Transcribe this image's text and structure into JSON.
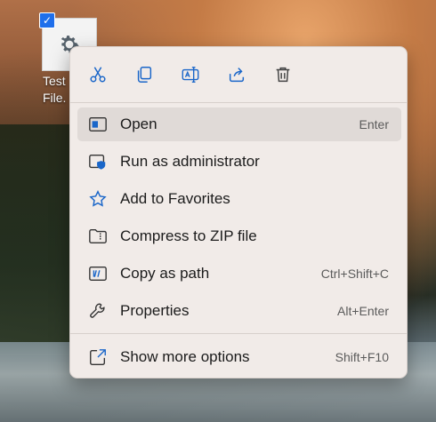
{
  "desktop": {
    "icon_label": "Test\nFile.",
    "icon_label_line1": "Test",
    "icon_label_line2": "File."
  },
  "toolbar": {
    "buttons": [
      {
        "name": "cut",
        "icon": "scissors-icon"
      },
      {
        "name": "copy",
        "icon": "copy-icon"
      },
      {
        "name": "rename",
        "icon": "rename-icon"
      },
      {
        "name": "share",
        "icon": "share-icon"
      },
      {
        "name": "delete",
        "icon": "trash-icon"
      }
    ]
  },
  "menu": {
    "items": [
      {
        "label": "Open",
        "shortcut": "Enter",
        "icon": "open-window-icon"
      },
      {
        "label": "Run as administrator",
        "shortcut": "",
        "icon": "shield-window-icon"
      },
      {
        "label": "Add to Favorites",
        "shortcut": "",
        "icon": "star-icon"
      },
      {
        "label": "Compress to ZIP file",
        "shortcut": "",
        "icon": "zip-folder-icon"
      },
      {
        "label": "Copy as path",
        "shortcut": "Ctrl+Shift+C",
        "icon": "copy-path-icon"
      },
      {
        "label": "Properties",
        "shortcut": "Alt+Enter",
        "icon": "wrench-icon"
      },
      {
        "label": "Show more options",
        "shortcut": "Shift+F10",
        "icon": "more-options-icon"
      }
    ]
  },
  "colors": {
    "accent": "#1f6feb",
    "menu_bg": "#f1ebe8",
    "hover_bg": "#e0dad7"
  }
}
